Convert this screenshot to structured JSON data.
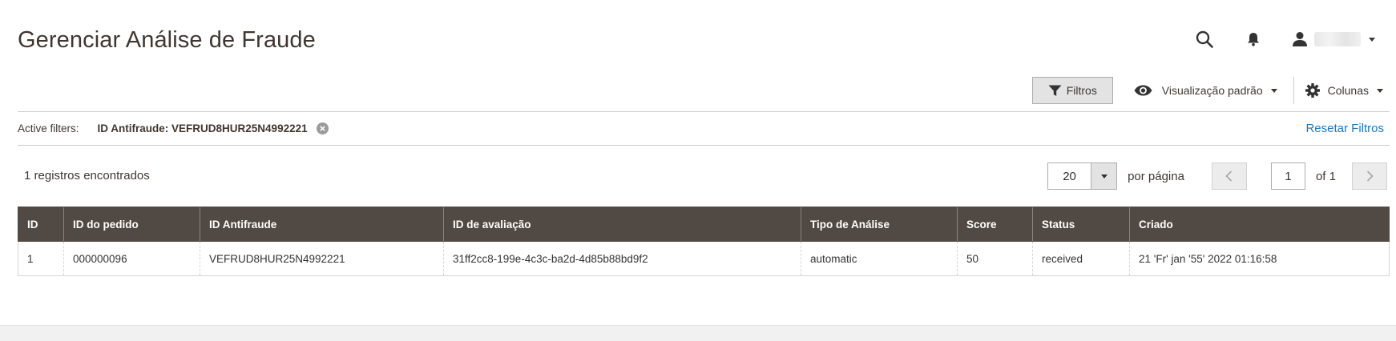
{
  "header": {
    "title": "Gerenciar Análise de Fraude"
  },
  "toolbar": {
    "filters_label": "Filtros",
    "view_label": "Visualização padrão",
    "columns_label": "Colunas"
  },
  "active_filters": {
    "label": "Active filters:",
    "items": [
      {
        "text": "ID Antifraude: VEFRUD8HUR25N4992221"
      }
    ],
    "reset_label": "Resetar Filtros"
  },
  "records": {
    "count_text": "1 registros encontrados"
  },
  "pager": {
    "per_page_value": "20",
    "per_page_label": "por página",
    "current_page": "1",
    "total_pages_text": "of 1"
  },
  "grid": {
    "columns": [
      "ID",
      "ID do pedido",
      "ID Antifraude",
      "ID de avaliação",
      "Tipo de Análise",
      "Score",
      "Status",
      "Criado"
    ],
    "rows": [
      [
        "1",
        "000000096",
        "VEFRUD8HUR25N4992221",
        "31ff2cc8-199e-4c3c-ba2d-4d85b88bd9f2",
        "automatic",
        "50",
        "received",
        "21 'Fr' jan '55' 2022 01:16:58"
      ]
    ]
  },
  "icons": {
    "search": "search-icon",
    "notifications": "bell-icon",
    "user": "user-icon",
    "filter": "funnel-icon",
    "view": "eye-icon",
    "columns": "gear-icon",
    "remove_filter": "close-circle-icon",
    "prev": "chevron-left-icon",
    "next": "chevron-right-icon"
  },
  "colors": {
    "grid_header_bg": "#514943",
    "link": "#1979c3",
    "title": "#41362f"
  }
}
